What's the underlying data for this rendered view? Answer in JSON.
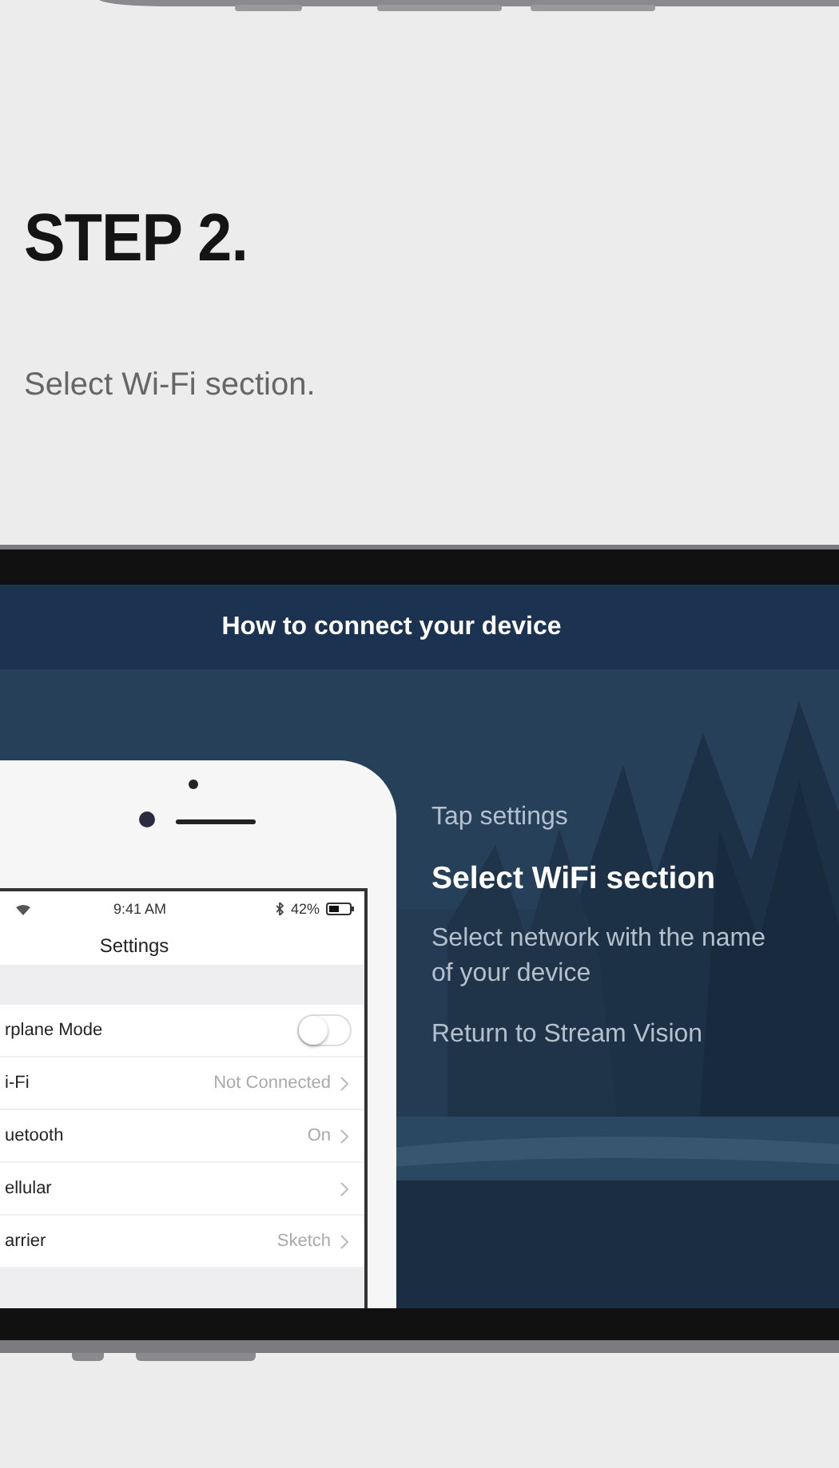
{
  "step": {
    "title": "STEP 2.",
    "description": "Select Wi-Fi section."
  },
  "app": {
    "title": "How to connect your device",
    "steps": [
      {
        "label": "Tap settings",
        "selected": false
      },
      {
        "label": "Select WiFi section",
        "selected": true
      },
      {
        "label": "Select network with the name of your device",
        "selected": false
      },
      {
        "label": "Return to Stream Vision",
        "selected": false
      }
    ]
  },
  "settings_mock": {
    "status_bar": {
      "time": "9:41 AM",
      "battery": "42%"
    },
    "title": "Settings",
    "rows": [
      {
        "kind": "toggle",
        "label": "rplane Mode",
        "on": false
      },
      {
        "kind": "link",
        "label": "i-Fi",
        "value": "Not Connected"
      },
      {
        "kind": "link",
        "label": "uetooth",
        "value": "On"
      },
      {
        "kind": "link",
        "label": "ellular"
      },
      {
        "kind": "link",
        "label": "arrier",
        "value": "Sketch"
      }
    ]
  }
}
